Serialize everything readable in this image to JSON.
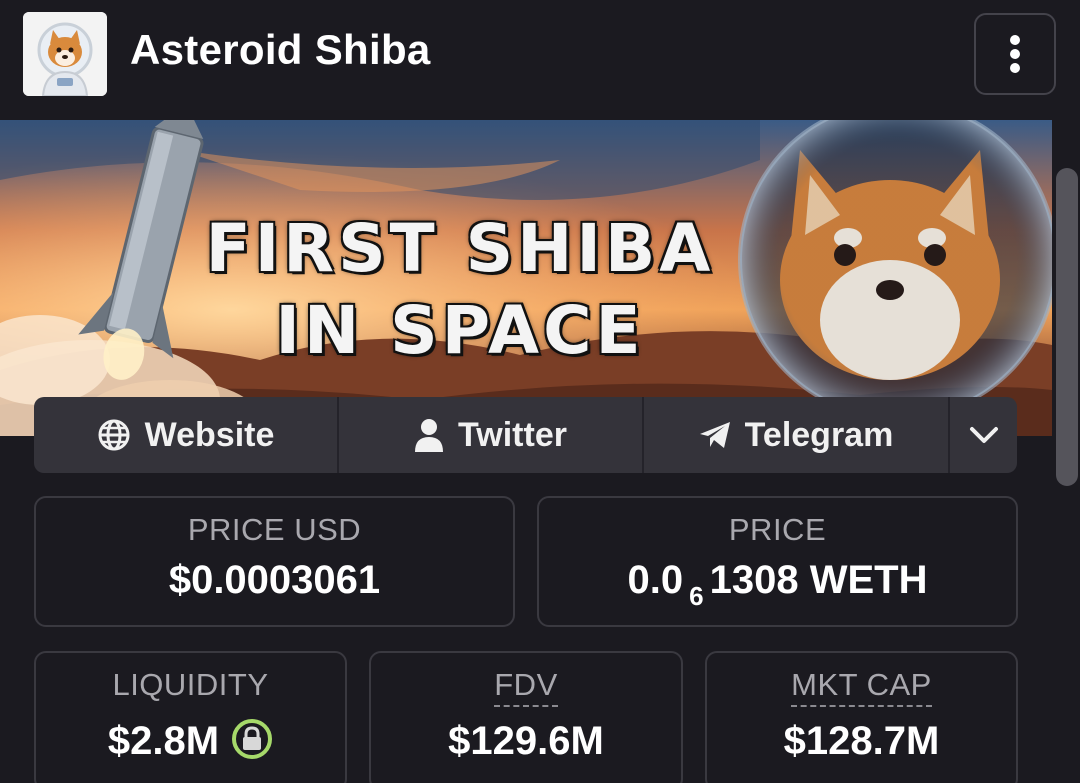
{
  "header": {
    "token_name": "Asteroid Shiba",
    "logo_icon": "shiba-astronaut-logo",
    "menu_icon": "kebab-menu-icon"
  },
  "banner": {
    "line1": "FIRST SHIBA",
    "line2": "IN SPACE"
  },
  "links": {
    "website": {
      "label": "Website",
      "icon": "globe-icon"
    },
    "twitter": {
      "label": "Twitter",
      "icon": "user-icon"
    },
    "telegram": {
      "label": "Telegram",
      "icon": "paper-plane-icon"
    },
    "more": {
      "icon": "chevron-down-icon"
    }
  },
  "stats": {
    "price_usd": {
      "label": "PRICE USD",
      "value": "$0.0003061"
    },
    "price": {
      "label": "PRICE",
      "value_prefix": "0.0",
      "value_subscript": "6",
      "value_suffix": "1308 WETH"
    },
    "liquidity": {
      "label": "LIQUIDITY",
      "value": "$2.8M",
      "badge_icon": "lock-icon"
    },
    "fdv": {
      "label": "FDV",
      "value": "$129.6M"
    },
    "mkt_cap": {
      "label": "MKT CAP",
      "value": "$128.7M"
    }
  },
  "colors": {
    "background": "#1b1a20",
    "card_border": "#3a3940",
    "links_bar": "#34333a",
    "label_text": "#a9a8ae",
    "lock_accent": "#a6d96a"
  }
}
